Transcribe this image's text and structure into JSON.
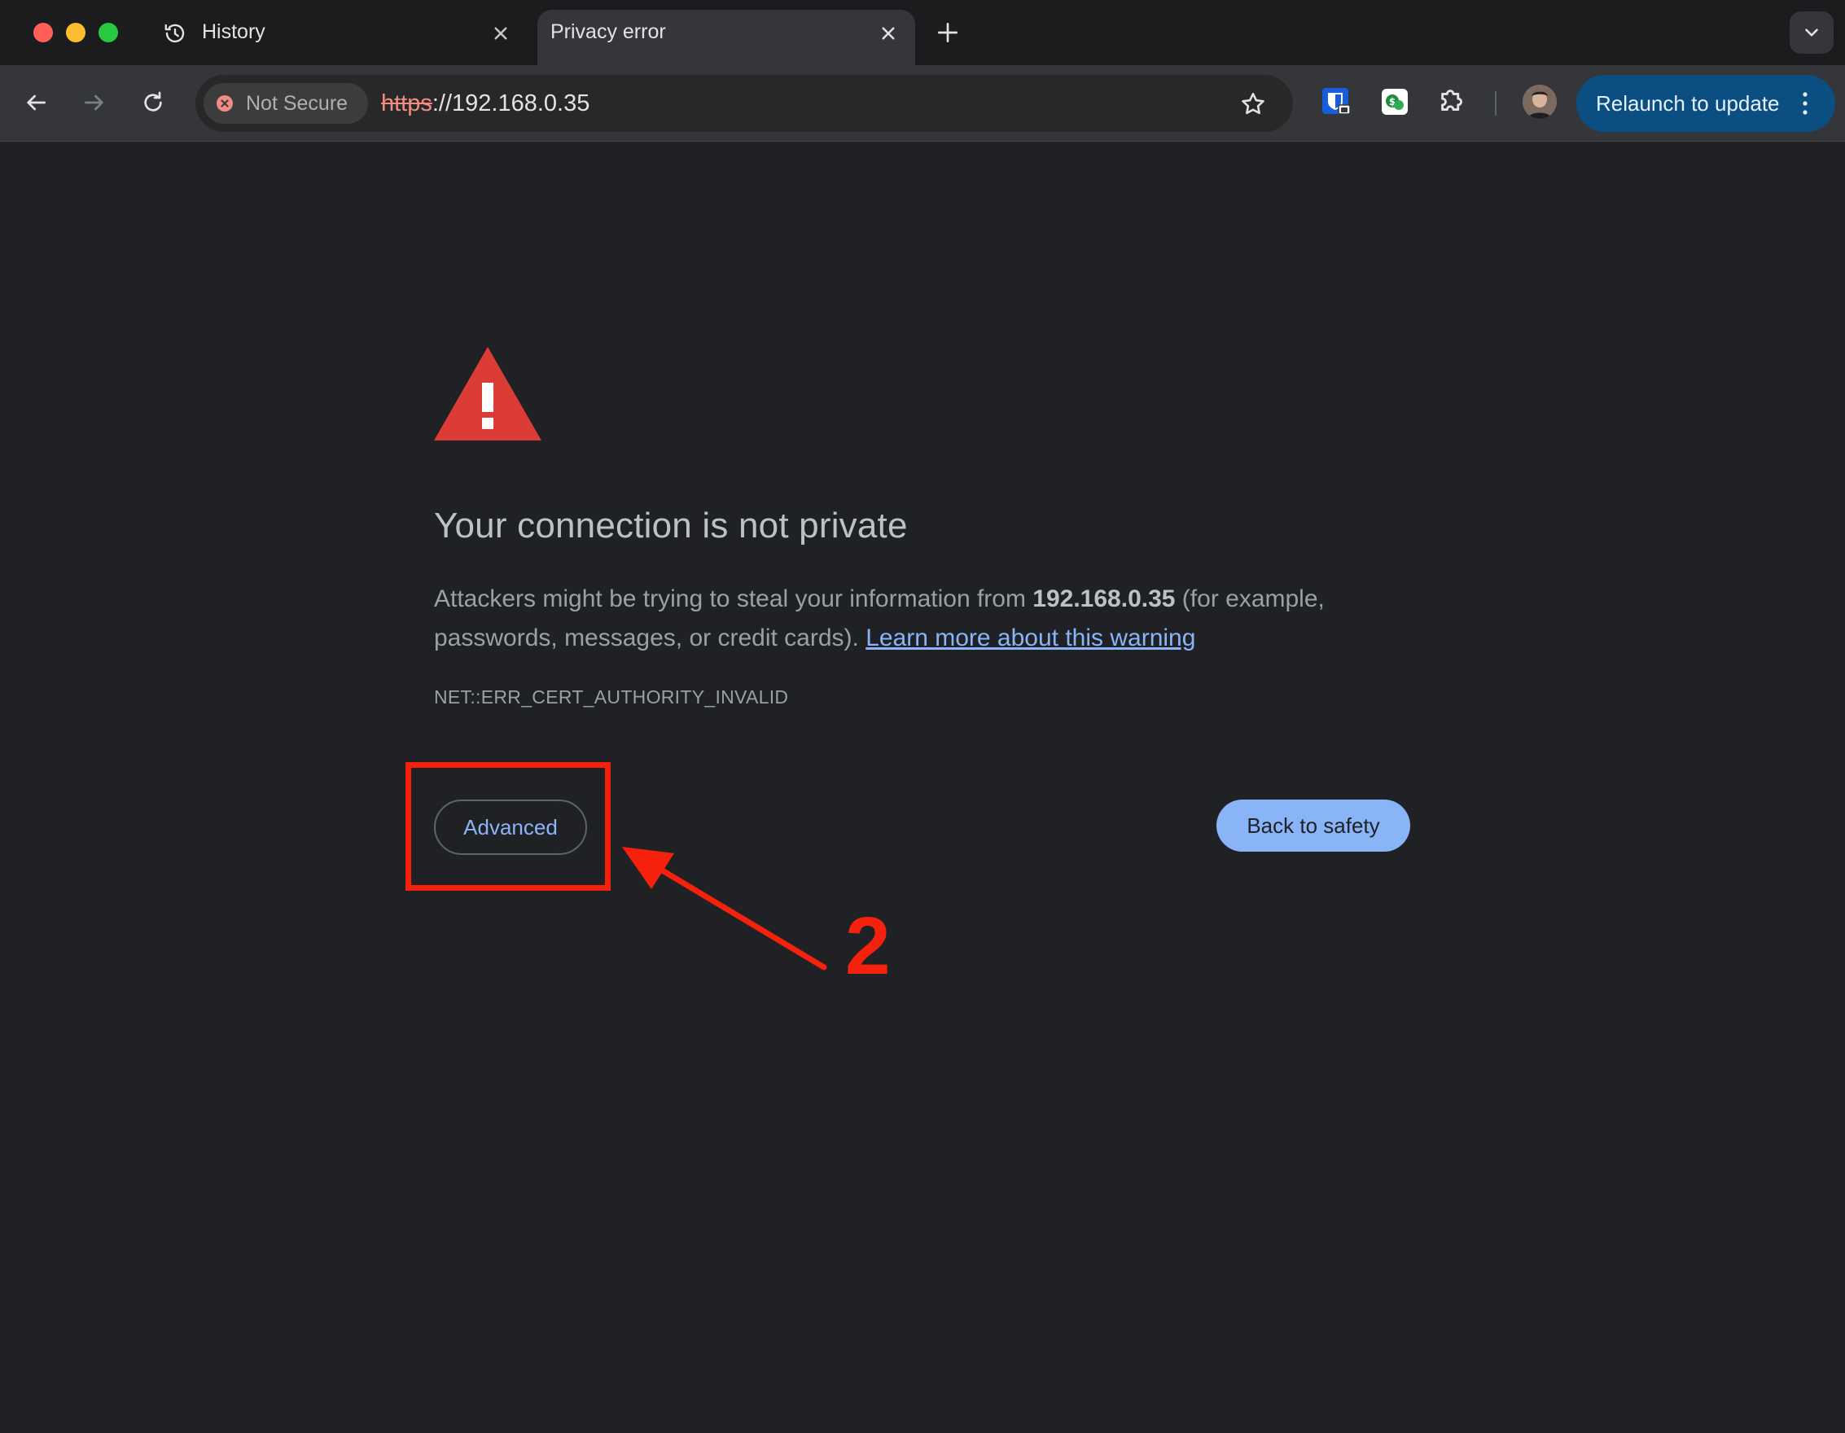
{
  "tabs": [
    {
      "title": "History",
      "icon": "history-icon",
      "active": false
    },
    {
      "title": "Privacy error",
      "icon": "",
      "active": true
    }
  ],
  "toolbar": {
    "security_label": "Not Secure",
    "url_scheme": "https",
    "url_rest": "://192.168.0.35",
    "relaunch_label": "Relaunch to update"
  },
  "interstitial": {
    "heading": "Your connection is not private",
    "body_prefix": "Attackers might be trying to steal your information from ",
    "host": "192.168.0.35",
    "body_suffix": " (for example, passwords, messages, or credit cards). ",
    "learn_more": "Learn more about this warning",
    "error_code": "NET::ERR_CERT_AUTHORITY_INVALID",
    "advanced_label": "Advanced",
    "back_label": "Back to safety"
  },
  "annotation": {
    "step_number": "2",
    "color": "#f5210c"
  },
  "colors": {
    "link": "#8ab4f8",
    "warning_red": "#db3d36",
    "relaunch_bg": "#0b4f82"
  }
}
